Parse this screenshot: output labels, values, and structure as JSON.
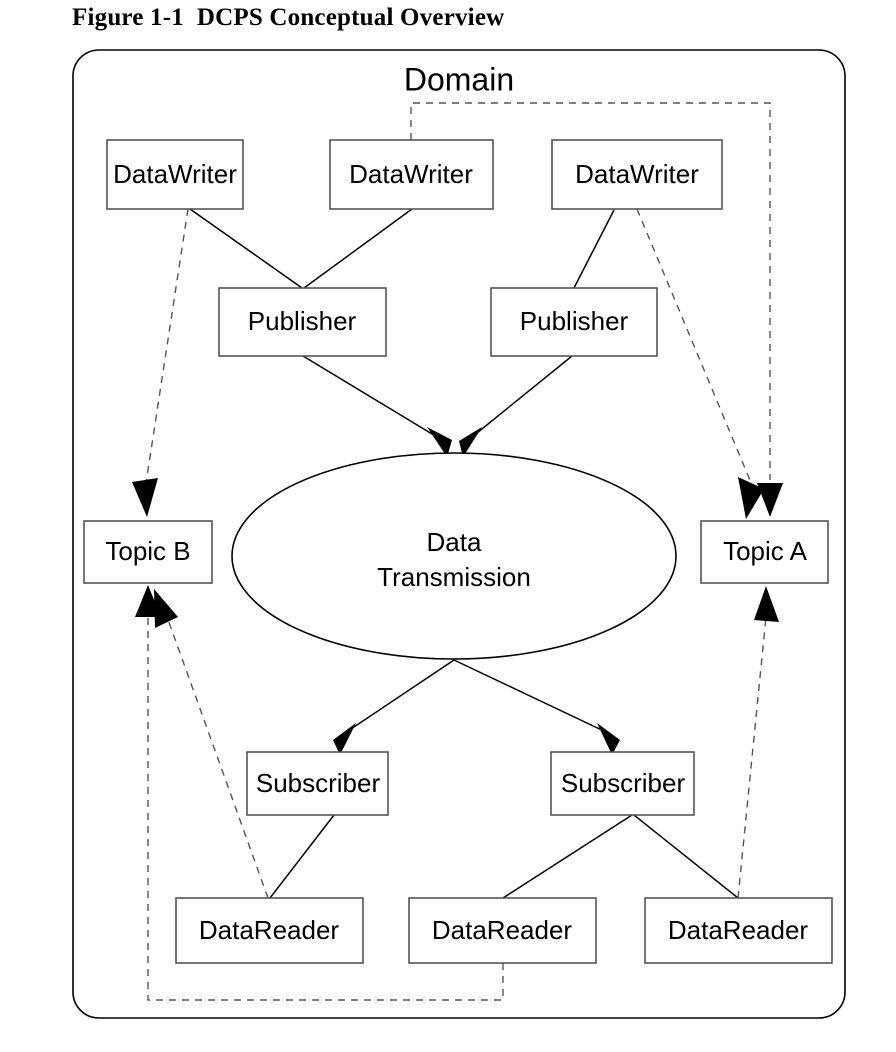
{
  "figure": {
    "title": "Figure 1-1  DCPS Conceptual Overview"
  },
  "container": {
    "label": "Domain"
  },
  "nodes": {
    "data_writers": [
      {
        "label": "DataWriter"
      },
      {
        "label": "DataWriter"
      },
      {
        "label": "DataWriter"
      }
    ],
    "publishers": [
      {
        "label": "Publisher"
      },
      {
        "label": "Publisher"
      }
    ],
    "topics": [
      {
        "label": "Topic B"
      },
      {
        "label": "Topic A"
      }
    ],
    "center": {
      "line1": "Data",
      "line2": "Transmission"
    },
    "subscribers": [
      {
        "label": "Subscriber"
      },
      {
        "label": "Subscriber"
      }
    ],
    "data_readers": [
      {
        "label": "DataReader"
      },
      {
        "label": "DataReader"
      },
      {
        "label": "DataReader"
      }
    ]
  },
  "colors": {
    "stroke": "#000000",
    "box_stroke": "#555555",
    "background": "#ffffff",
    "dashed_stroke": "#555555"
  }
}
